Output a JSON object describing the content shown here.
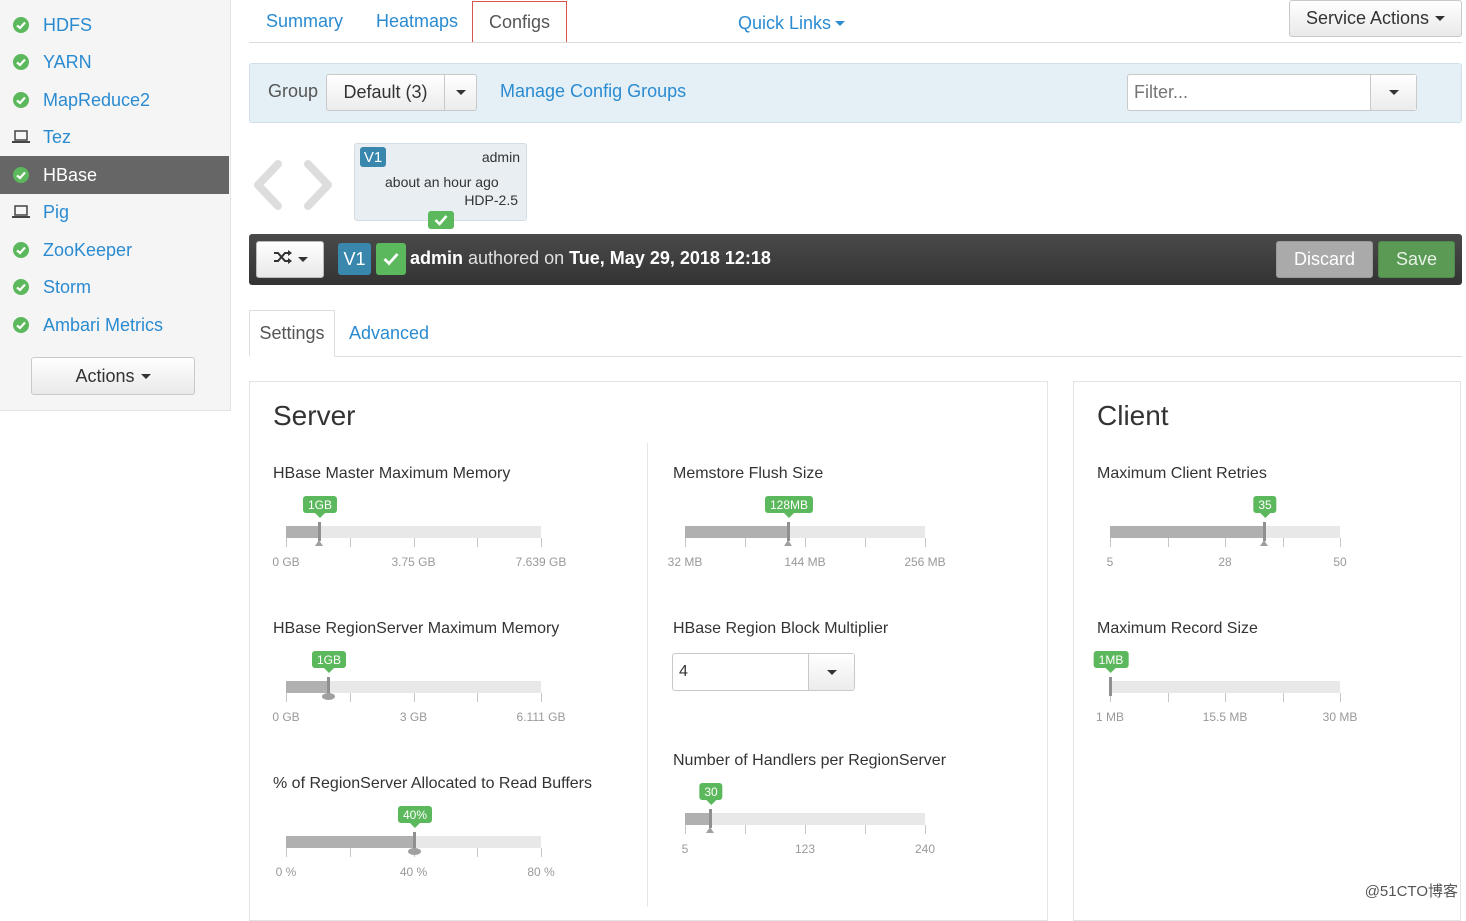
{
  "sidebar": {
    "items": [
      {
        "label": "HDFS",
        "icon": "check-circle-icon",
        "status": "ok"
      },
      {
        "label": "YARN",
        "icon": "check-circle-icon",
        "status": "ok"
      },
      {
        "label": "MapReduce2",
        "icon": "check-circle-icon",
        "status": "ok"
      },
      {
        "label": "Tez",
        "icon": "laptop-icon",
        "status": "client"
      },
      {
        "label": "HBase",
        "icon": "check-circle-icon",
        "status": "ok",
        "active": true
      },
      {
        "label": "Pig",
        "icon": "laptop-icon",
        "status": "client"
      },
      {
        "label": "ZooKeeper",
        "icon": "check-circle-icon",
        "status": "ok"
      },
      {
        "label": "Storm",
        "icon": "check-circle-icon",
        "status": "ok"
      },
      {
        "label": "Ambari Metrics",
        "icon": "check-circle-icon",
        "status": "ok"
      }
    ],
    "actions_label": "Actions"
  },
  "nav": {
    "tabs": [
      "Summary",
      "Heatmaps",
      "Configs"
    ],
    "active_tab": "Configs",
    "quick_links": "Quick Links",
    "service_actions": "Service Actions"
  },
  "group_bar": {
    "group_label": "Group",
    "group_value": "Default (3)",
    "manage_link": "Manage Config Groups",
    "filter_placeholder": "Filter..."
  },
  "version_box": {
    "badge": "V1",
    "author": "admin",
    "time": "about an hour ago",
    "stack": "HDP-2.5"
  },
  "version_bar": {
    "badge": "V1",
    "author": "admin",
    "authored_on": "authored on",
    "date": "Tue, May 29, 2018 12:18",
    "discard": "Discard",
    "save": "Save"
  },
  "subtabs": {
    "settings": "Settings",
    "advanced": "Advanced"
  },
  "server": {
    "title": "Server",
    "master_memory": {
      "label": "HBase Master Maximum Memory",
      "value": "1GB",
      "fraction": 0.131,
      "ticks": [
        "0 GB",
        "3.75 GB",
        "7.639 GB"
      ]
    },
    "regionserver_memory": {
      "label": "HBase RegionServer Maximum Memory",
      "value": "1GB",
      "fraction": 0.164,
      "ticks": [
        "0 GB",
        "3 GB",
        "6.111 GB"
      ]
    },
    "read_buffers": {
      "label": "% of RegionServer Allocated to Read Buffers",
      "value": "40%",
      "fraction": 0.5,
      "ticks": [
        "0 %",
        "40 %",
        "80 %"
      ]
    },
    "memstore_flush": {
      "label": "Memstore Flush Size",
      "value": "128MB",
      "fraction": 0.43,
      "ticks": [
        "32 MB",
        "144 MB",
        "256 MB"
      ]
    },
    "block_multiplier": {
      "label": "HBase Region Block Multiplier",
      "value": "4"
    },
    "handlers": {
      "label": "Number of Handlers per RegionServer",
      "value": "30",
      "fraction": 0.106,
      "ticks": [
        "5",
        "123",
        "240"
      ]
    }
  },
  "client": {
    "title": "Client",
    "client_retries": {
      "label": "Maximum Client Retries",
      "value": "35",
      "fraction": 0.67,
      "ticks": [
        "5",
        "28",
        "50"
      ]
    },
    "record_size": {
      "label": "Maximum Record Size",
      "value": "1MB",
      "fraction": 0.0,
      "ticks": [
        "1 MB",
        "15.5 MB",
        "30 MB"
      ]
    }
  },
  "watermark": "@51CTO博客"
}
